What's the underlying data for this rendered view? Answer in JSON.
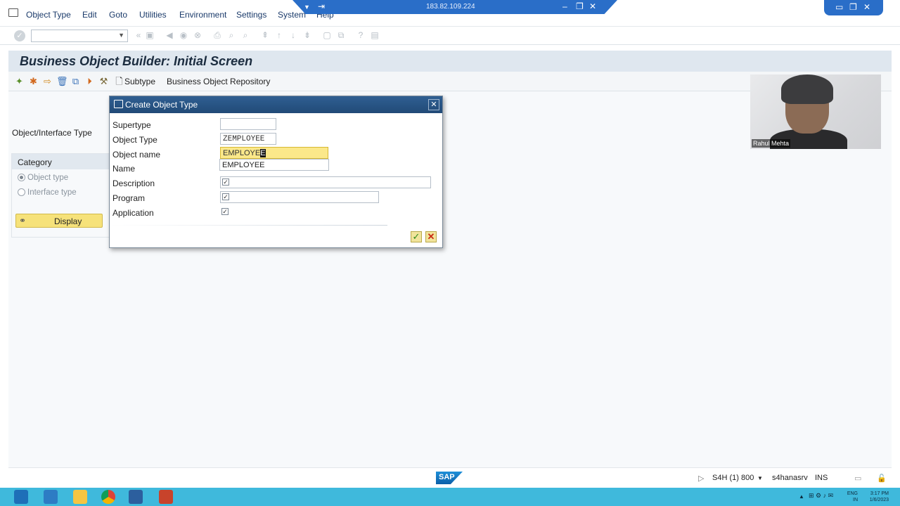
{
  "menubar": {
    "items": [
      "Object Type",
      "Edit",
      "Goto",
      "Utilities",
      "Environment",
      "Settings",
      "System",
      "Help"
    ]
  },
  "remote_bar": {
    "ip": "183.82.109.224"
  },
  "page_title": "Business Object Builder: Initial Screen",
  "app_toolbar": {
    "subtype_label": "Subtype",
    "repository_label": "Business Object Repository"
  },
  "main": {
    "object_interface_label": "Object/Interface Type",
    "category_label": "Category",
    "radio_object_type": "Object type",
    "radio_interface_type": "Interface type",
    "display_label": "Display"
  },
  "dialog": {
    "title": "Create Object Type",
    "fields": {
      "supertype_label": "Supertype",
      "supertype_value": "",
      "object_type_label": "Object Type",
      "object_type_value": "ZEMPLOYEE",
      "object_name_label": "Object name",
      "object_name_value": "EMPLOYE",
      "object_name_cursor": "E",
      "object_name_suggestion": "EMPLOYEE",
      "name_label": "Name",
      "description_label": "Description",
      "program_label": "Program",
      "application_label": "Application"
    }
  },
  "webcam": {
    "name": "Rahul Mehta"
  },
  "statusbar": {
    "logo": "SAP",
    "system": "S4H (1) 800",
    "server": "s4hanasrv",
    "mode": "INS"
  },
  "taskbar": {
    "lang_top": "ENG",
    "lang_bottom": "IN",
    "time": "3:17 PM",
    "date": "1/6/2023"
  },
  "colors": {
    "dialog_header": "#2f5f92",
    "focus_field": "#fbe88a",
    "taskbar": "#3fb9dc",
    "title_bar": "#dfe7ef"
  }
}
